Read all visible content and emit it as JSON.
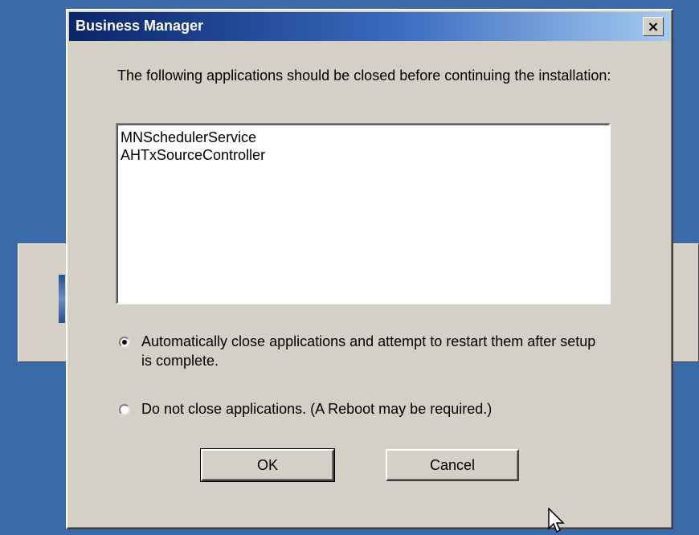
{
  "dialog": {
    "title": "Business Manager",
    "close_label": "×",
    "message": "The following applications should be closed before continuing the installation:",
    "applications": [
      "MNSchedulerService",
      "AHTxSourceController"
    ],
    "options": [
      {
        "label": "Automatically close applications and attempt to restart them after setup is complete.",
        "selected": true
      },
      {
        "label": "Do not close applications. (A Reboot may be required.)",
        "selected": false
      }
    ],
    "ok_label": "OK",
    "cancel_label": "Cancel"
  },
  "colors": {
    "desktop": "#3b6aa8",
    "dialog_face": "#d4d0c8",
    "titlebar_start": "#0a246a",
    "titlebar_end": "#a6caf0"
  },
  "icons": {
    "close": "close-icon",
    "cursor": "mouse-cursor-icon",
    "background_app": "app-icon"
  }
}
